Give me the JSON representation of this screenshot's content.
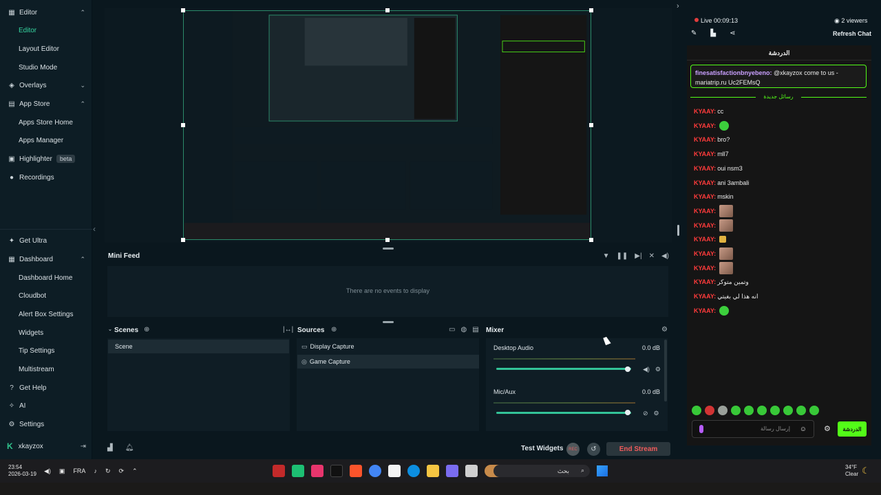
{
  "sidebar": {
    "editor": "Editor",
    "editor_sub": [
      "Editor",
      "Layout Editor",
      "Studio Mode"
    ],
    "overlays": "Overlays",
    "app_store": "App Store",
    "app_store_sub": [
      "Apps Store Home",
      "Apps Manager"
    ],
    "highlighter": "Highlighter",
    "beta": "beta",
    "recordings": "Recordings",
    "get_ultra": "Get Ultra",
    "dashboard": "Dashboard",
    "dashboard_sub": [
      "Dashboard Home",
      "Cloudbot",
      "Alert Box Settings",
      "Widgets",
      "Tip Settings",
      "Multistream"
    ],
    "get_help": "Get Help",
    "ai": "AI",
    "settings": "Settings",
    "username": "xkayzox"
  },
  "mini_feed": {
    "title": "Mini Feed",
    "empty": "There are no events to display"
  },
  "scenes": {
    "title": "Scenes",
    "items": [
      "Scene"
    ]
  },
  "sources": {
    "title": "Sources",
    "items": [
      {
        "label": "Display Capture",
        "icon": "monitor-icon"
      },
      {
        "label": "Game Capture",
        "icon": "gamepad-icon"
      }
    ]
  },
  "mixer": {
    "title": "Mixer",
    "channels": [
      {
        "label": "Desktop Audio",
        "db": "0.0 dB",
        "volume": 1.0
      },
      {
        "label": "Mic/Aux",
        "db": "0.0 dB",
        "volume": 1.0
      }
    ]
  },
  "footer": {
    "test_widgets": "Test Widgets",
    "rec": "REC",
    "end_stream": "End Stream"
  },
  "chat": {
    "live": "Live 00:09:13",
    "viewers": "2 viewers",
    "refresh": "Refresh Chat",
    "header": "الدردشة",
    "pinned_user": "finesatisfactionbnyebeno:",
    "pinned_text": "@xkayzox come to us - mariatrip.ru Uc2FEMsQ",
    "new_messages": "رسائل جديدة",
    "messages": [
      {
        "user": "KYAAY:",
        "text": "cc",
        "emote": ""
      },
      {
        "user": "KYAAY:",
        "text": "",
        "emote": "green"
      },
      {
        "user": "KYAAY:",
        "text": "bro?",
        "emote": ""
      },
      {
        "user": "KYAAY:",
        "text": "mll7",
        "emote": ""
      },
      {
        "user": "KYAAY:",
        "text": "oui nsm3",
        "emote": ""
      },
      {
        "user": "KYAAY:",
        "text": "ani 3ambali",
        "emote": ""
      },
      {
        "user": "KYAAY:",
        "text": "mskin",
        "emote": ""
      },
      {
        "user": "KYAAY:",
        "text": "",
        "emote": "img"
      },
      {
        "user": "KYAAY:",
        "text": "",
        "emote": "img"
      },
      {
        "user": "KYAAY:",
        "text": "",
        "emote": "small"
      },
      {
        "user": "KYAAY:",
        "text": "",
        "emote": "img"
      },
      {
        "user": "KYAAY:",
        "text": "",
        "emote": "img"
      },
      {
        "user": "KYAAY:",
        "text": "وتمين متوكر",
        "emote": ""
      },
      {
        "user": "KYAAY:",
        "text": "انه هذا لي بغيتي",
        "emote": ""
      },
      {
        "user": "KYAAY:",
        "text": "",
        "emote": "green"
      }
    ],
    "input_placeholder": "إرسال رسالة",
    "send": "الدردشة"
  },
  "taskbar": {
    "time": "23:54",
    "date": "2026-03-19",
    "lang": "FRA",
    "search": "بحث",
    "temp": "34°F",
    "weather": "Clear"
  }
}
